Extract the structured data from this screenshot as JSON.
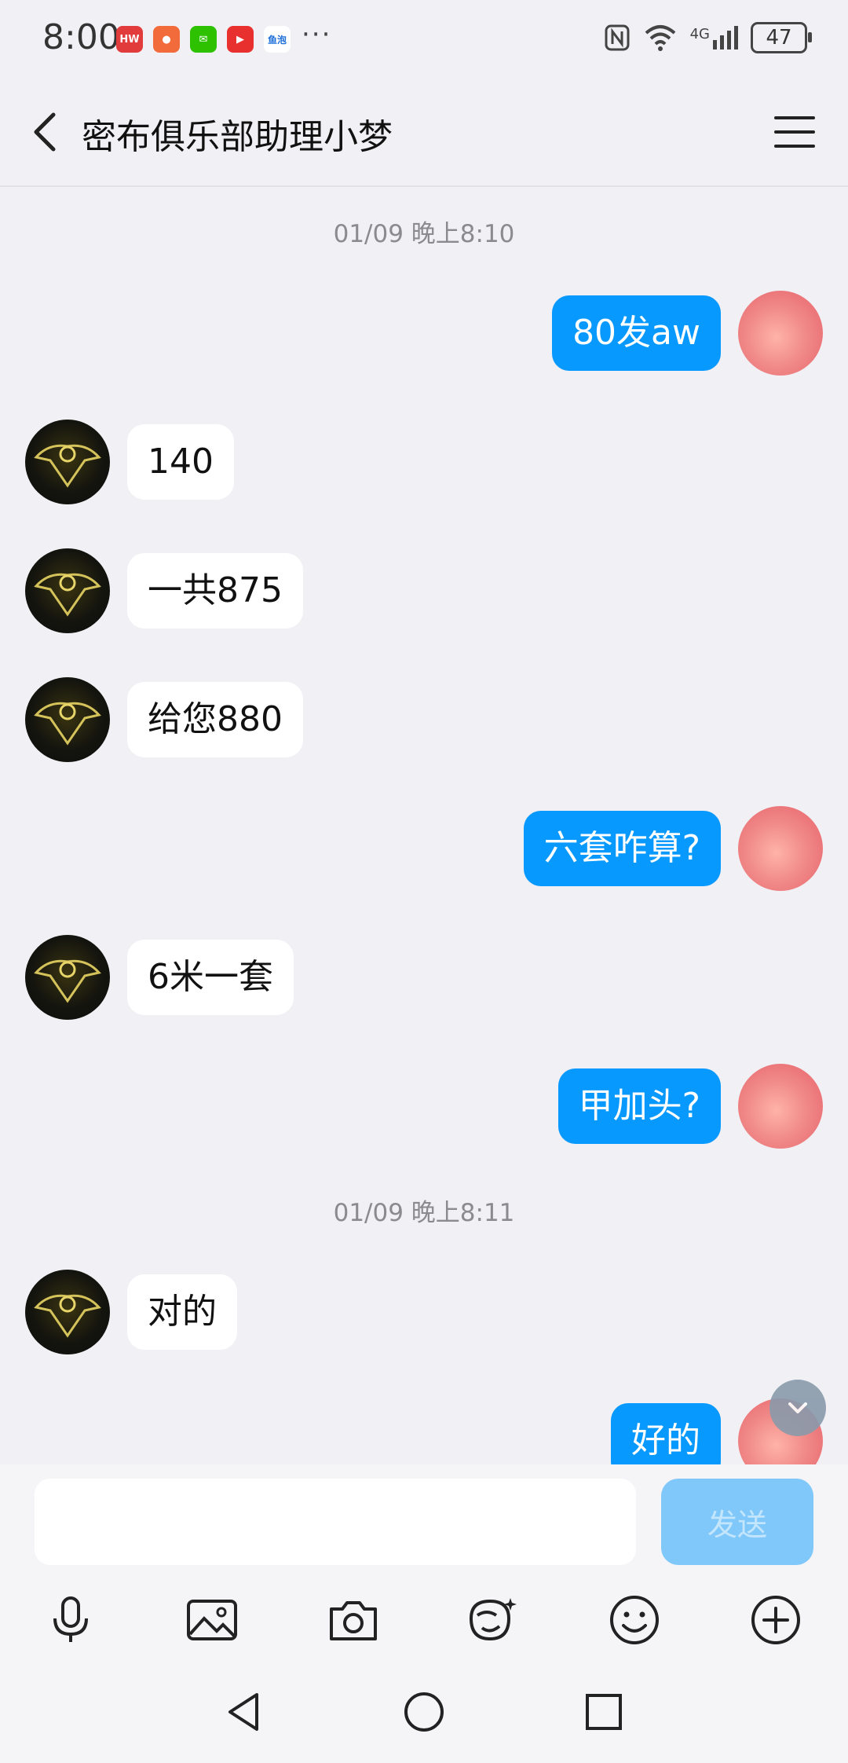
{
  "status_bar": {
    "time": "8:00",
    "signal_label": "4G",
    "battery": "47",
    "overflow": "···",
    "notif_apps": [
      {
        "name": "huawei-app-icon",
        "color": "#e23b3b",
        "glyph": "HW"
      },
      {
        "name": "orange-app-icon",
        "color": "#f26b3a",
        "glyph": "●"
      },
      {
        "name": "wechat-icon",
        "color": "#2dc100",
        "glyph": "✉"
      },
      {
        "name": "video-app-icon",
        "color": "#e8312f",
        "glyph": "▶"
      },
      {
        "name": "yupao-app-icon",
        "color": "#ffffff",
        "glyph": "鱼泡"
      }
    ]
  },
  "header": {
    "title": "密布俱乐部助理小梦"
  },
  "messages": [
    {
      "type": "timestamp",
      "text": "01/09 晚上8:10"
    },
    {
      "side": "right",
      "text": "80发aw"
    },
    {
      "side": "left",
      "text": "140"
    },
    {
      "side": "left",
      "text": "一共875"
    },
    {
      "side": "left",
      "text": "给您880"
    },
    {
      "side": "right",
      "text": "六套咋算?"
    },
    {
      "side": "left",
      "text": "6米一套"
    },
    {
      "side": "right",
      "text": "甲加头?"
    },
    {
      "type": "timestamp",
      "text": "01/09 晚上8:11"
    },
    {
      "side": "left",
      "text": "对的"
    },
    {
      "side": "right",
      "text": "好的"
    }
  ],
  "input": {
    "value": "",
    "placeholder": "",
    "send_label": "发送"
  },
  "toolbar": [
    "microphone-icon",
    "image-icon",
    "camera-icon",
    "sticker-icon",
    "emoji-icon",
    "plus-icon"
  ],
  "colors": {
    "accent": "#0899ff",
    "send_disabled": "#80c8fa",
    "background": "#f0f0f5"
  }
}
